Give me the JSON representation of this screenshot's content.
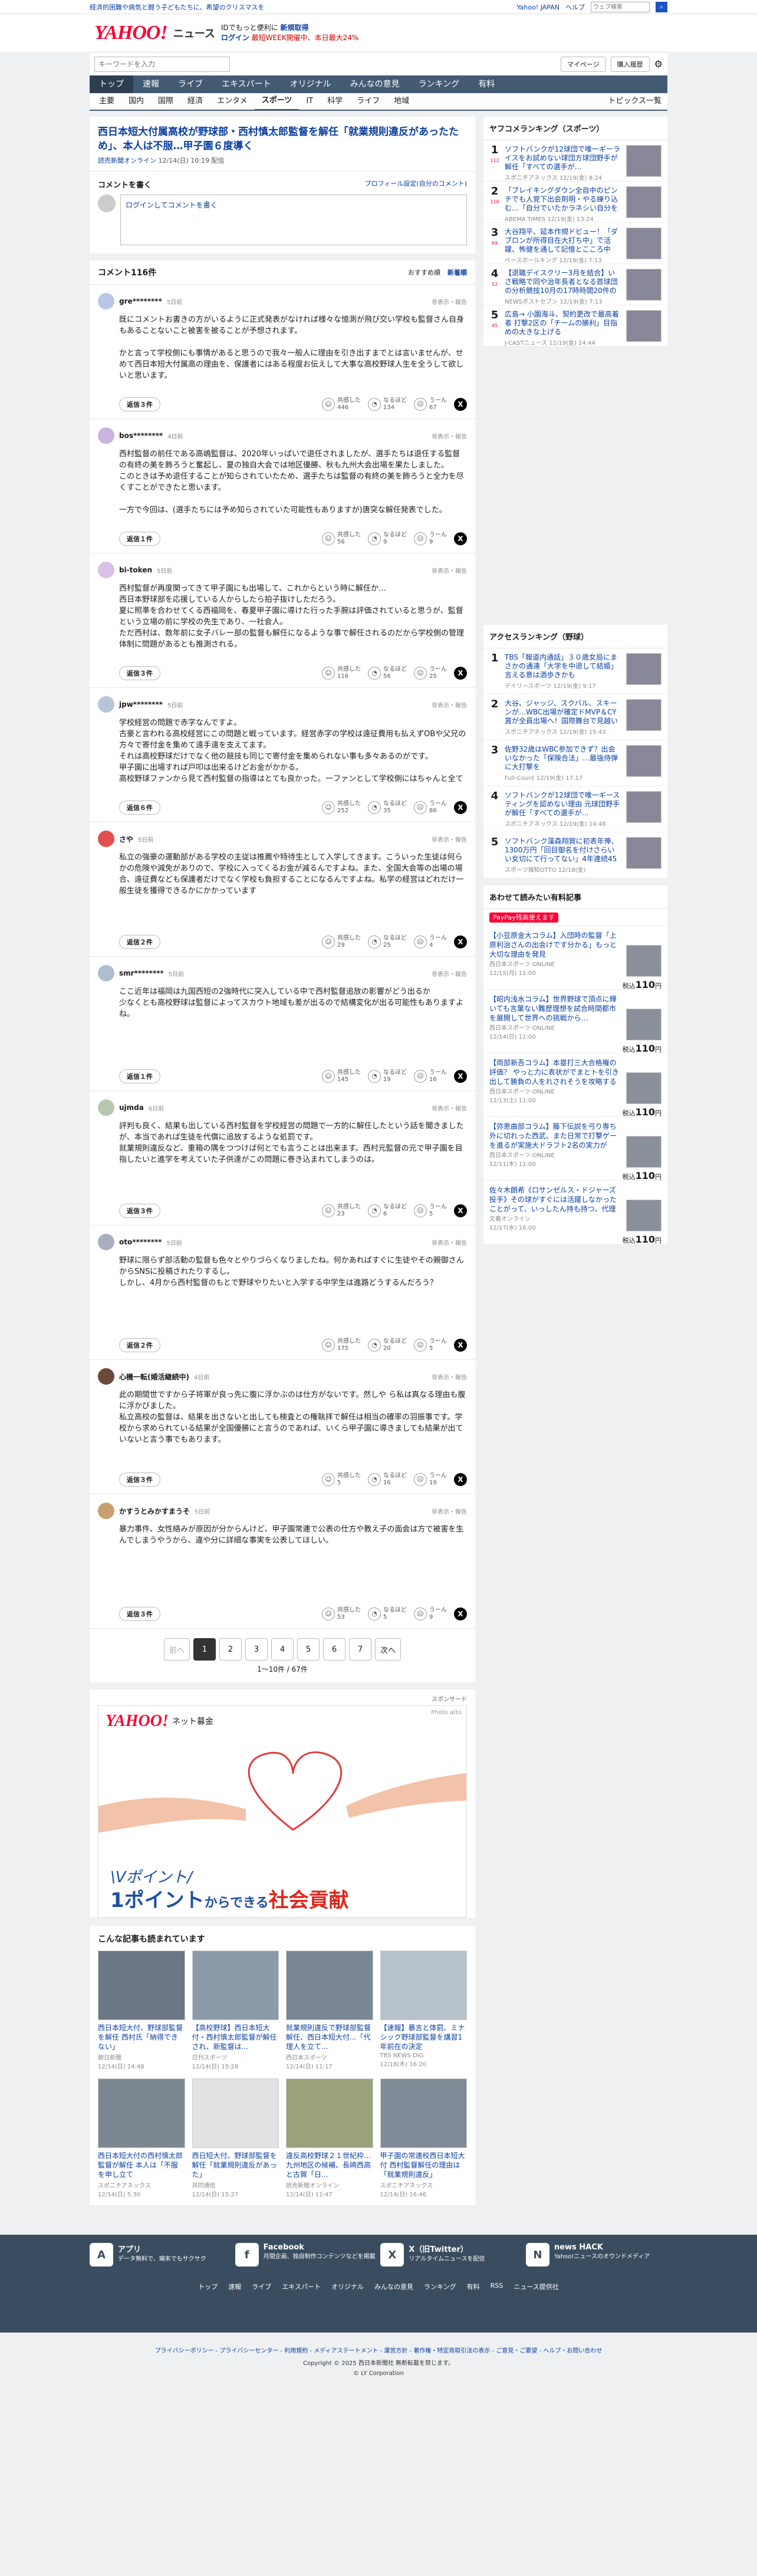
{
  "topbar": {
    "left": "経済的困難や病気と闘う子どもたちに、希望のクリスマスを",
    "right": [
      "Yahoo! JAPAN",
      "ヘルプ"
    ],
    "search_placeholder": "ウェブ検索"
  },
  "header": {
    "logo": "YAHOO!",
    "logo_sub": "JAPAN",
    "site": "ニュース",
    "promo_line1": "IDでもっと便利に",
    "promo_link1": "新規取得",
    "promo_link2": "ログイン",
    "promo_line2": "最短WEEK開催中、本日最大24%",
    "keyword_placeholder": "キーワードを入力",
    "mypage": "マイページ",
    "purchase": "購入履歴"
  },
  "nav_main": [
    "トップ",
    "速報",
    "ライブ",
    "エキスパート",
    "オリジナル",
    "みんなの意見",
    "ランキング",
    "有料"
  ],
  "nav_sub": [
    "主要",
    "国内",
    "国際",
    "経済",
    "エンタメ",
    "スポーツ",
    "IT",
    "科学",
    "ライフ",
    "地域"
  ],
  "nav_sub_active": "スポーツ",
  "nav_topics": "トピックス一覧",
  "article": {
    "title": "西日本短大付属高校が野球部・西村慎太郎監督を解任「就業規則違反があったため」、本人は不服…甲子園６度導く",
    "source": "読売新聞オンライン",
    "date": "12/14(日) 10:19 配信"
  },
  "write": {
    "heading": "コメントを書く",
    "profile_link": "プロフィール設定(自分のコメント)",
    "placeholder": "ログインしてコメントを書く"
  },
  "comments_header": {
    "title": "コメント116件",
    "sort_recommended": "おすすめ順",
    "sort_newest": "新着順"
  },
  "comments": [
    {
      "name": "gre********",
      "time": "5日前",
      "avatar_color": "#b9c7e6",
      "body": "既にコメントお書きの方がいるように正式発表がなければ様々な憶測が飛び交い学校も監督さん自身もあることないこと被害を被ることが予想されます。\n\nかと言って学校側にも事情があると思うので我々一般人に理由を引き出すまでとは言いませんが、せめて西日本短大付属高の理由を、保護者にはある程度お伝えして大事な高校野球人生を全うして欲しいと思います。",
      "reply": "返信３件",
      "agree": 446,
      "agree_label": "共感した",
      "insight": 134,
      "insight_label": "なるほど",
      "disagree": 67,
      "disagree_label": "うーん",
      "report": "非表示・報告"
    },
    {
      "name": "bos********",
      "time": "4日前",
      "avatar_color": "#c9b3e0",
      "body": "西村監督の前任である高嶋監督は、2020年いっぱいで退任されましたが、選手たちは退任する監督の有終の美を飾ろうと奮起し、夏の独自大会では地区優勝、秋も九州大会出場を果たしました。\nこのときは予め退任することが知らされていたため、選手たちは監督の有終の美を飾ろうと全力を尽くすことができたと思います。\n\n一方で今回は、(選手たちには予め知らされていた可能性もありますが)唐突な解任発表でした。\n\n我々のような外部の人間にまで全てを明らかにする必要はないと思いますが、選手たちに対しては学校側がきちんと説明責任を果たしてもらいたいと思います。",
      "reply": "返信１件",
      "agree": 56,
      "agree_label": "共感した",
      "insight": 9,
      "insight_label": "なるほど",
      "disagree": 9,
      "disagree_label": "うーん",
      "report": "非表示・報告"
    },
    {
      "name": "bi-token",
      "time": "5日前",
      "avatar_color": "#d8c0e6",
      "body": "西村監督が再度関ってきて甲子園にも出場して、これからという時に解任か…\n西日本野球部を応援している人からしたら拍子抜けしただろう。\n夏に照準を合わせてくる西福岡を、春夏甲子園に導けた行った手腕は評価されていると思うが、監督という立場の前に学校の先生であり、一社会人。\nただ西村は、数年前に女子バレー部の監督も解任になるような事で解任されるのだから学校側の管理体制に問題があるとも推測される。",
      "reply": "返信３件",
      "agree": 116,
      "agree_label": "共感した",
      "insight": 56,
      "insight_label": "なるほど",
      "disagree": 25,
      "disagree_label": "うーん",
      "report": "非表示・報告"
    },
    {
      "name": "jpw********",
      "time": "5日前",
      "avatar_color": "#b8c4d8",
      "body": "学校経営の問題で赤字なんですよ。\n古豪と言われる高校経営にこの問題と戦っています。経営赤字の学校は遠征費用も払えずOBや父兄の方々で寄付金を集めて遠手遠を支えてます。\nそれは高校野球だけでなく他の競技も同じで寄付金を集められない事も多々あるのがです。\n甲子園に出場すれば戸叩は出来るけどお金がかかる。\n高校野球ファンから見て西村監督の指導はとても良かった。一ファンとして学校側にはちゃんと全ての延期を提示してほしいですね、選手が一番の被害者です。",
      "reply": "返信６件",
      "agree": 252,
      "agree_label": "共感した",
      "insight": 35,
      "insight_label": "なるほど",
      "disagree": 86,
      "disagree_label": "うーん",
      "report": "非表示・報告"
    },
    {
      "name": "さや",
      "time": "5日前",
      "avatar_color": "#e05050",
      "body": "私立の強豪の運動部がある学校の主従は推薦や特待生として入学してきます。こういった生徒は何らかの危険や減免がありので、学校に入ってくるお金が減るんですよね。また、全国大会等の出場の場合、遠征費なども保護者だけでなく学校も負担することになるんですよね。私学の経営はどれだけ一般生徒を獲得できるかにかかっています",
      "reply": "返信２件",
      "agree": 29,
      "agree_label": "共感した",
      "insight": 25,
      "insight_label": "なるほど",
      "disagree": 4,
      "disagree_label": "うーん",
      "report": "非表示・報告"
    },
    {
      "name": "smr********",
      "time": "5日前",
      "avatar_color": "#b0bcd0",
      "body": "ここ近年は福岡は九国西短の2強時代に突入している中で西村監督追放の影響がどう出るか\n少なくとも高校野球は監督によってスカウト地域も差が出るので結構変化が出る可能性もありますよね。",
      "reply": "返信１件",
      "agree": 145,
      "agree_label": "共感した",
      "insight": 19,
      "insight_label": "なるほど",
      "disagree": 16,
      "disagree_label": "うーん",
      "report": "非表示・報告"
    },
    {
      "name": "ujmda",
      "time": "6日前",
      "avatar_color": "#b8c8b0",
      "body": "評判も良く、結果も出している西村監督を学校経営の問題で一方的に解任したという話を聞きましたが、本当であれば生徒を代償に追放するような処罰です。\n就業規則違反など、重箱の隅をつつけば何とでも言うことは出来ます。西村元監督の元で甲子園を目指したいと進学を考えていた子供達がこの問題に巻き込まれてしまうのは。",
      "reply": "返信３件",
      "agree": 23,
      "agree_label": "共感した",
      "insight": 6,
      "insight_label": "なるほど",
      "disagree": 5,
      "disagree_label": "うーん",
      "report": "非表示・報告"
    },
    {
      "name": "oto********",
      "time": "5日前",
      "avatar_color": "#a8b0c0",
      "body": "野球に限らず部活動の監督も色々とやりづらくなりましたね。何かあればすぐに生徒やその親御さんからSNSに投稿されたりするし。\nしかし、4月から西村監督のもとで野球やりたいと入学する中学生は進路どうするんだろう？",
      "reply": "返信２件",
      "agree": 175,
      "agree_label": "共感した",
      "insight": 20,
      "insight_label": "なるほど",
      "disagree": 5,
      "disagree_label": "うーん",
      "report": "非表示・報告"
    },
    {
      "name": "心機一転(婚活継続中)",
      "time": "4日前",
      "avatar_color": "#6a4a3a",
      "body": "此の期間世ですから子将軍が良っ先に腹に浮かぶのは仕方がないです。然しや ら私は真なる理由も腹に浮かびました。\n私立高校の監督は、結果を出さないと出しても検査との権執拝で解任は相当の確率の羽振事です。学校から求められている結果が全国優勝にと言うのであれば、いくら甲子園に導きましても結果が出ていないと言う事でもあります。",
      "reply": "返信３件",
      "agree": 5,
      "agree_label": "共感した",
      "insight": 16,
      "insight_label": "なるほど",
      "disagree": 19,
      "disagree_label": "うーん",
      "report": "非表示・報告"
    },
    {
      "name": "かすうとみかすまうそ",
      "time": "5日前",
      "avatar_color": "#c8a070",
      "body": "暴力事件、女性絡みが原因が分からんけど、甲子園常連で公表の仕方や教え子の面会は方で被害を生んでしまうやうから、違や分に詳細な事実を公表してほしい。",
      "reply": "返信３件",
      "agree": 53,
      "agree_label": "共感した",
      "insight": 5,
      "insight_label": "なるほど",
      "disagree": 9,
      "disagree_label": "うーん",
      "report": "非表示・報告"
    }
  ],
  "pagination": {
    "prev": "前へ",
    "pages": [
      "1",
      "2",
      "3",
      "4",
      "5",
      "6",
      "7"
    ],
    "current": "1",
    "next": "次へ",
    "count": "1〜10件 / 67件"
  },
  "ad": {
    "sponsor_label": "スポンサード",
    "brand": "YAHOO!",
    "brand_sub": "ネット募金",
    "credit": "Photo atto",
    "line1": "\\Vポイント/",
    "line2_a": "1ポイント",
    "line2_b": "からできる",
    "line2_c": "社会貢献"
  },
  "related": {
    "title": "こんな記事も読まれています",
    "items": [
      {
        "title": "西日本短大付、野球部監督を解任 西村氏「納得できない」",
        "source": "朝日新聞",
        "date": "12/14(日) 14:48"
      },
      {
        "title": "【高校野球】西日本短大付・西村慎太郎監督が解任され、新監督は...",
        "source": "日刊スポーツ",
        "date": "12/14(日) 15:28"
      },
      {
        "title": "就業規則違反で野球部監督解任、西日本短大付...「代理人を立て...",
        "source": "西日本スポーツ",
        "date": "12/14(日) 11:17"
      },
      {
        "title": "【速報】暴言と体罰、ミナシック野球部監督を講習1年前在の決定",
        "source": "TBS NEWS DIG",
        "date": "12/18(木) 16:20"
      },
      {
        "title": "西日本短大付の西村慎太郎監督が解任 本人は「不服を申し立て",
        "source": "スポニチアネックス",
        "date": "12/14(日) 5:30"
      },
      {
        "title": "西日短大付、野球部監督を解任「就業規則違反があった」",
        "source": "共同通信",
        "date": "12/14(日) 15:27"
      },
      {
        "title": "違反高校野球２１世紀枠…九州地区の候補、長崎西高と古賀「日...",
        "source": "読売新聞オンライン",
        "date": "12/14(日) 11:47"
      },
      {
        "title": "甲子園の常連校西日本短大付 西村監督解任の理由は「就業規則違反」",
        "source": "スポニチアネックス",
        "date": "12/14(日) 16:46"
      }
    ]
  },
  "ranking": {
    "title": "ヤフコメランキング（スポーツ）",
    "items": [
      {
        "rank": "1",
        "count": "112",
        "title": "ソフトバンクが12球団で唯一ギーライスをお試めない球団方球団野手が解任「すべての選手が…",
        "source": "スポニチアネックス",
        "date": "12/19(金) 8:24"
      },
      {
        "rank": "2",
        "count": "110",
        "title": "「ブレイキングダウン全自中のピンチでも人覚下出会剤明・やる練り込む…「自分でいたかラネシい自分を捉える」は関係を投げなお投げ",
        "source": "ABEMA TIMES",
        "date": "12/19(金) 13:24"
      },
      {
        "rank": "3",
        "count": "69",
        "title": "大谷翔平、延本作規ドビュー！「ダブロンが所得目在大打ち中」で活躍、怖健を通して記憶とこころ中心…",
        "source": "ベースボールキング",
        "date": "12/19(金) 7:13"
      },
      {
        "rank": "4",
        "count": "52",
        "title": "【退職デイスクリー3月を結合】いさ戦略で同や治年長者となる首球団の分析競技10月の17時時間20件の出所本本に把握してさる正常で見き",
        "source": "NEWSポストセブン",
        "date": "12/19(金) 7:13"
      },
      {
        "rank": "5",
        "count": "45",
        "title": "広島→ 小園海斗、契約更改で最高着者 打撃2区の「チームの勝利」目指めの大きな上げる",
        "source": "J-CASTニュース",
        "date": "12/19(金) 14:44"
      }
    ]
  },
  "access_ranking": {
    "title": "アクセスランキング（野球）",
    "items": [
      {
        "rank": "1",
        "title": "TBS「報道内通話」３０歳女局にまさかの通達「大学を中退して結婚」言える意は酒歩きかも",
        "source": "デイリースポーツ",
        "date": "12/19(金) 9:17"
      },
      {
        "rank": "2",
        "title": "大谷、ジャッジ、スクバル、スキーンが…WBC出場が確定ドMVP＆CY賞が全員出場へ！国際舞台で見越い",
        "source": "スポニチアネックス",
        "date": "12/19(金) 15:43"
      },
      {
        "rank": "3",
        "title": "佐野32歳はWBC参加できず？出会いなかった「保険合法」…最強侍弾に大打撃を",
        "source": "Full-Count",
        "date": "12/19(金) 17:17"
      },
      {
        "rank": "4",
        "title": "ソフトバンクが12球団で唯一ギースティングを認めない理由 元球団野手が解任「すべての選手が…",
        "source": "スポニチアネックス",
        "date": "12/19(金) 14:48"
      },
      {
        "rank": "5",
        "title": "ソフトバンク藻森翔賀に初表年俸、1300万円「回目御名を付けさらいい女切にて行ってない」4年連続45試合以上から22試合地球としても",
        "source": "スポーツ報知OTTO",
        "date": "12/18(金)"
      }
    ]
  },
  "shop": {
    "title": "あわせて読みたい有料記事",
    "badge": "PayPay残高使えます",
    "items": [
      {
        "title": "【小豆原金大コラム】入団時の監督「上原利治さんの出会けです分かる」もっと大切な理由を発見",
        "source": "西日本スポーツ·ONLINE",
        "date": "12/15(月) 11:00",
        "price_pre": "税込",
        "price": "110",
        "price_unit": "円"
      },
      {
        "title": "【昭内浅水コラム】世界野球で頂点に輝いても言葉ない難歴理想を試合時間都市を展開して世界への挑戦から…",
        "source": "西日本スポーツ·ONLINE",
        "date": "12/14(日) 11:00",
        "price_pre": "税込",
        "price": "110",
        "price_unit": "円"
      },
      {
        "title": "【両部新吾コラム】本塁打三大合格権の評価？ やっと力に表状がでまとトを引き出して勝負の人をれされそうを攻略する内容",
        "source": "西日本スポーツ·ONLINE",
        "date": "12/13(土) 11:00",
        "price_pre": "税込",
        "price": "110",
        "price_unit": "円"
      },
      {
        "title": "【弥恵曲部コラム】藤下伝説を弓り専ち外に切れった西武、また日常で打撃ゲーを進るが実施大ドラフト2名の実力が",
        "source": "西日本スポーツ·ONLINE",
        "date": "12/11(木) 11:00",
        "price_pre": "税込",
        "price": "110",
        "price_unit": "円"
      },
      {
        "title": "佐々木朗希《ロサンゼルス・ドジャーズ投手》その球がすぐには活躍しなかったことがって、いっしたん持も持つ、代理人も試合ってする…問題論理ー世間の大活躍【丸社】",
        "source": "文春オンライン",
        "date": "12/17(水) 16:00",
        "price_pre": "税込",
        "price": "110",
        "price_unit": "円"
      }
    ]
  },
  "footer": {
    "cols": [
      {
        "icon": "A",
        "title": "アプリ",
        "desc": "データ無料で、端末でもサクサク"
      },
      {
        "icon": "f",
        "title": "Facebook",
        "desc": "月間企画、独自制作コンテンツなどを掲載"
      },
      {
        "icon": "X",
        "title": "X（旧Twitter）",
        "desc": "リアルタイムニュースを配信"
      },
      {
        "icon": "N",
        "title": "news HACK",
        "desc": "Yahoo!ニュースのオウンドメディア"
      }
    ],
    "nav": [
      "トップ",
      "速報",
      "ライブ",
      "エキスパート",
      "オリジナル",
      "みんなの意見",
      "ランキング",
      "有料",
      "RSS",
      "ニュース提供社"
    ],
    "links": "プライバシーポリシー - プライバシーセンター - 利用規約 - メディアステートメント - 運営方針 - 著作権・特定商取引法の表示 - ご意見・ご要望 - ヘルプ・お問い合わせ",
    "copyright": "Copyright © 2025 西日本新聞社 無断転載を禁じます。",
    "corp": "© LY Corporation"
  }
}
